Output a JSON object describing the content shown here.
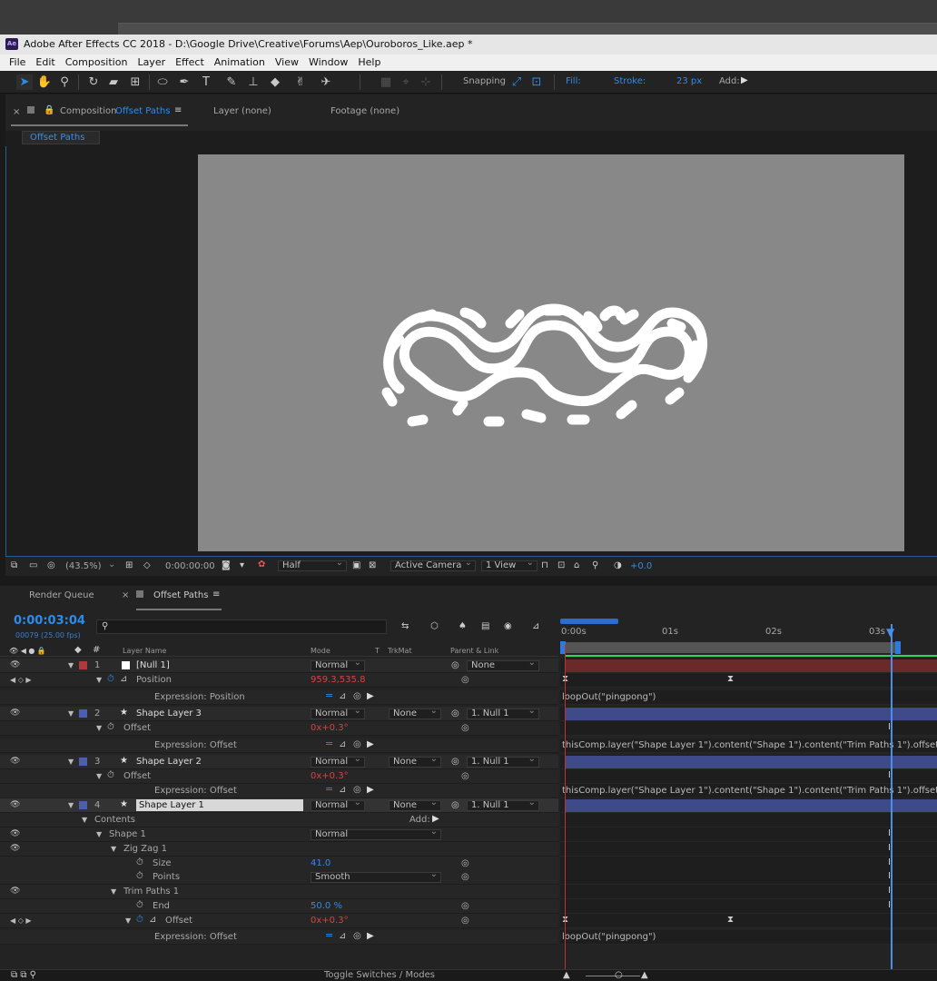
{
  "window": {
    "title": "Adobe After Effects CC 2018 - D:\\Google Drive\\Creative\\Forums\\Aep\\Ouroboros_Like.aep *",
    "logo": "Ae"
  },
  "menu": [
    "File",
    "Edit",
    "Composition",
    "Layer",
    "Effect",
    "Animation",
    "View",
    "Window",
    "Help"
  ],
  "toolbar": {
    "snapping": "Snapping",
    "fill": "Fill:",
    "stroke": "Stroke:",
    "stroke_px": "23 px",
    "add": "Add:"
  },
  "panels": {
    "close": "×",
    "comp_label": "Composition",
    "comp_name": "Offset Paths",
    "layer": "Layer (none)",
    "footage": "Footage (none)",
    "breadcrumb": "Offset Paths"
  },
  "comp_footer": {
    "zoom": "(43.5%)",
    "time": "0:00:00:00",
    "resolution": "Half",
    "camera": "Active Camera",
    "views": "1 View",
    "exposure": "+0.0"
  },
  "timeline": {
    "tabs": {
      "render_queue": "Render Queue",
      "comp": "Offset Paths"
    },
    "current_time": "0:00:03:04",
    "fps": "00079 (25.00 fps)",
    "ruler": [
      "0:00s",
      "01s",
      "02s",
      "03s"
    ],
    "columns": {
      "layer_name": "Layer Name",
      "mode": "Mode",
      "t": "T",
      "trkmat": "TrkMat",
      "parent": "Parent & Link"
    },
    "toggle": "Toggle Switches / Modes"
  },
  "rows": [
    {
      "num": "1",
      "name": "[Null 1]",
      "mode": "Normal",
      "parent": "None"
    },
    {
      "prop": "Position",
      "value": "959.3,535.8"
    },
    {
      "expr_label": "Expression: Position",
      "expr": "loopOut(\"pingpong\")"
    },
    {
      "num": "2",
      "name": "Shape Layer 3",
      "mode": "Normal",
      "trkmat": "None",
      "parent": "1. Null 1"
    },
    {
      "prop": "Offset",
      "value": "0x+0.3°"
    },
    {
      "expr_label": "Expression: Offset",
      "expr": "thisComp.layer(\"Shape Layer 1\").content(\"Shape 1\").content(\"Trim Paths 1\").offset"
    },
    {
      "num": "3",
      "name": "Shape Layer 2",
      "mode": "Normal",
      "trkmat": "None",
      "parent": "1. Null 1"
    },
    {
      "prop": "Offset",
      "value": "0x+0.3°"
    },
    {
      "expr_label": "Expression: Offset",
      "expr": "thisComp.layer(\"Shape Layer 1\").content(\"Shape 1\").content(\"Trim Paths 1\").offset"
    },
    {
      "num": "4",
      "name": "Shape Layer 1",
      "mode": "Normal",
      "trkmat": "None",
      "parent": "1. Null 1"
    },
    {
      "group": "Contents",
      "add": "Add:"
    },
    {
      "group": "Shape 1",
      "mode": "Normal"
    },
    {
      "group": "Zig Zag 1"
    },
    {
      "prop": "Size",
      "value": "41.0"
    },
    {
      "prop": "Points",
      "value": "Smooth"
    },
    {
      "group": "Trim Paths 1"
    },
    {
      "prop": "End",
      "value": "50.0 %"
    },
    {
      "prop": "Offset",
      "value": "0x+0.3°"
    },
    {
      "expr_label": "Expression: Offset",
      "expr": "loopOut(\"pingpong\")"
    }
  ],
  "colors": {
    "accent": "#2d8ceb",
    "null_label": "#b03a3a",
    "shape_label": "#4a5fb0",
    "stage": "#888888",
    "red_value": "#d44444",
    "work_area": "#2fd46b"
  }
}
